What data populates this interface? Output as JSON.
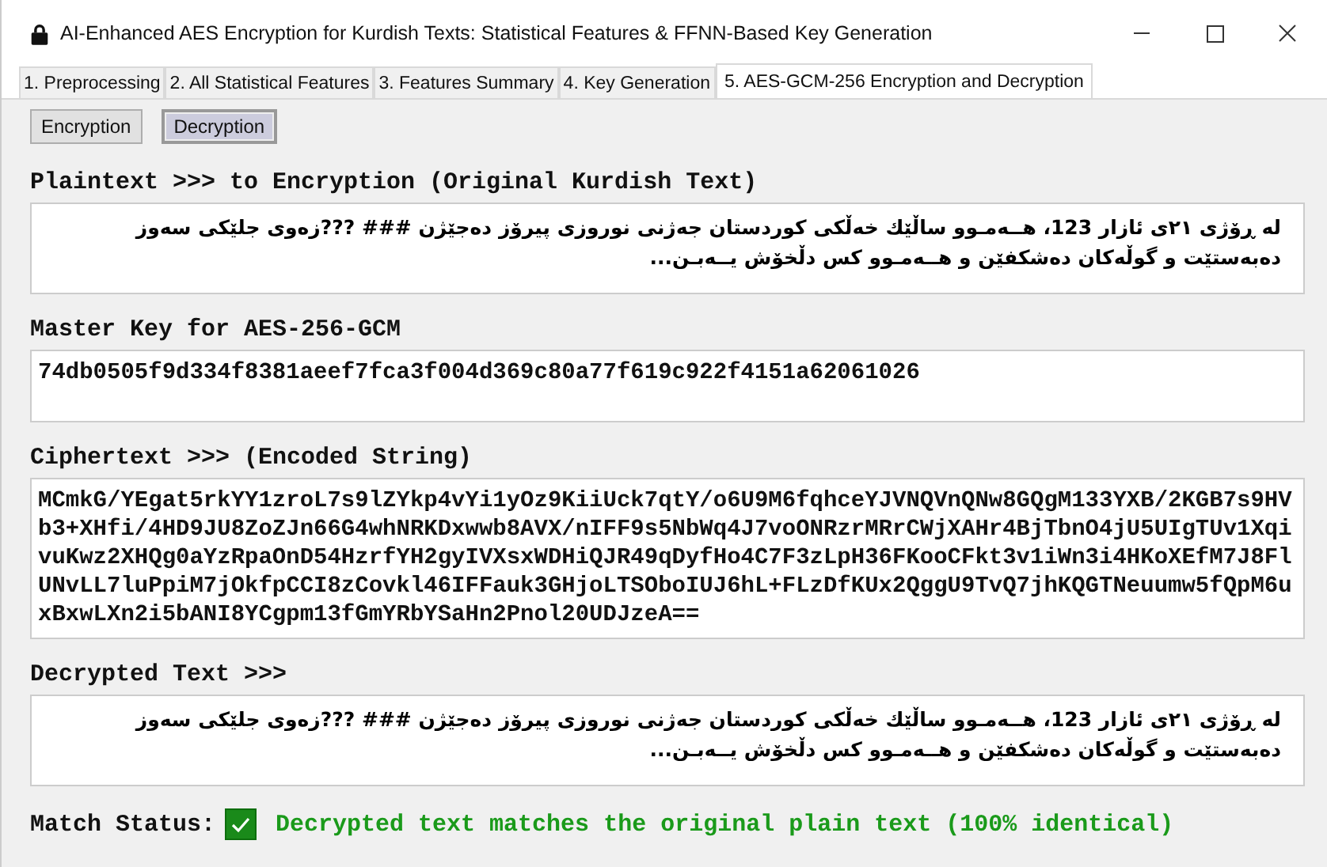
{
  "window": {
    "title": "AI-Enhanced AES Encryption for Kurdish Texts:  Statistical Features & FFNN-Based Key Generation"
  },
  "tabs": [
    {
      "label": "1. Preprocessing",
      "selected": false
    },
    {
      "label": "2. All Statistical Features",
      "selected": false
    },
    {
      "label": "3. Features Summary",
      "selected": false
    },
    {
      "label": "4. Key Generation",
      "selected": false
    },
    {
      "label": "5. AES-GCM-256 Encryption and Decryption",
      "selected": true
    }
  ],
  "mode_buttons": [
    {
      "label": "Encryption",
      "selected": false
    },
    {
      "label": "Decryption",
      "selected": true
    }
  ],
  "sections": [
    {
      "kind": "rtl",
      "label": "Plaintext >>> to Encryption (Original Kurdish Text)",
      "value": "له ڕۆژی ٢١ی ئازار 123، هــەمـوو ساڵێك خەڵكی كوردستان جەژنی نوروزی پیرۆز دەجێژن ### ???زەوی جلێكی سەوز دەبەستێت و گوڵەكان دەشكفێن و هــەمـوو كس دڵخۆش یــەبـن..."
    },
    {
      "kind": "code",
      "label": "Master Key for AES-256-GCM",
      "value": "74db0505f9d334f8381aeef7fca3f004d369c80a77f619c922f4151a62061026"
    },
    {
      "kind": "code",
      "label": "Ciphertext >>> (Encoded String)",
      "value": "MCmkG/YEgat5rkYY1zroL7s9lZYkp4vYi1yOz9KiiUck7qtY/o6U9M6fqhceYJVNQVnQNw8GQgM133YXB/2KGB7s9HVb3+XHfi/4HD9JU8ZoZJn66G4whNRKDxwwb8AVX/nIFF9s5NbWq4J7voONRzrMRrCWjXAHr4BjTbnO4jU5UIgTUv1XqivuKwz2XHQg0aYzRpaOnD54HzrfYH2gyIVXsxWDHiQJR49qDyfHo4C7F3zLpH36FKooCFkt3v1iWn3i4HKoXEfM7J8FlUNvLL7luPpiM7jOkfpCCI8zCovkl46IFFauk3GHjoLTSOboIUJ6hL+FLzDfKUx2QggU9TvQ7jhKQGTNeuumw5fQpM6uxBxwLXn2i5bANI8YCgpm13fGmYRbYSaHn2Pnol20UDJzeA=="
    },
    {
      "kind": "rtl",
      "label": "Decrypted Text >>>",
      "value": "له ڕۆژی ٢١ی ئازار 123، هــەمـوو ساڵێك خەڵكی كوردستان جەژنی نوروزی پیرۆز دەجێژن ### ???زەوی جلێكی سەوز دەبەستێت و گوڵەكان دەشكفێن و هــەمـوو كس دڵخۆش یــەبـن..."
    }
  ],
  "match": {
    "label": "Match Status:",
    "checked": true,
    "message": "Decrypted text matches the original plain text (100% identical)"
  }
}
